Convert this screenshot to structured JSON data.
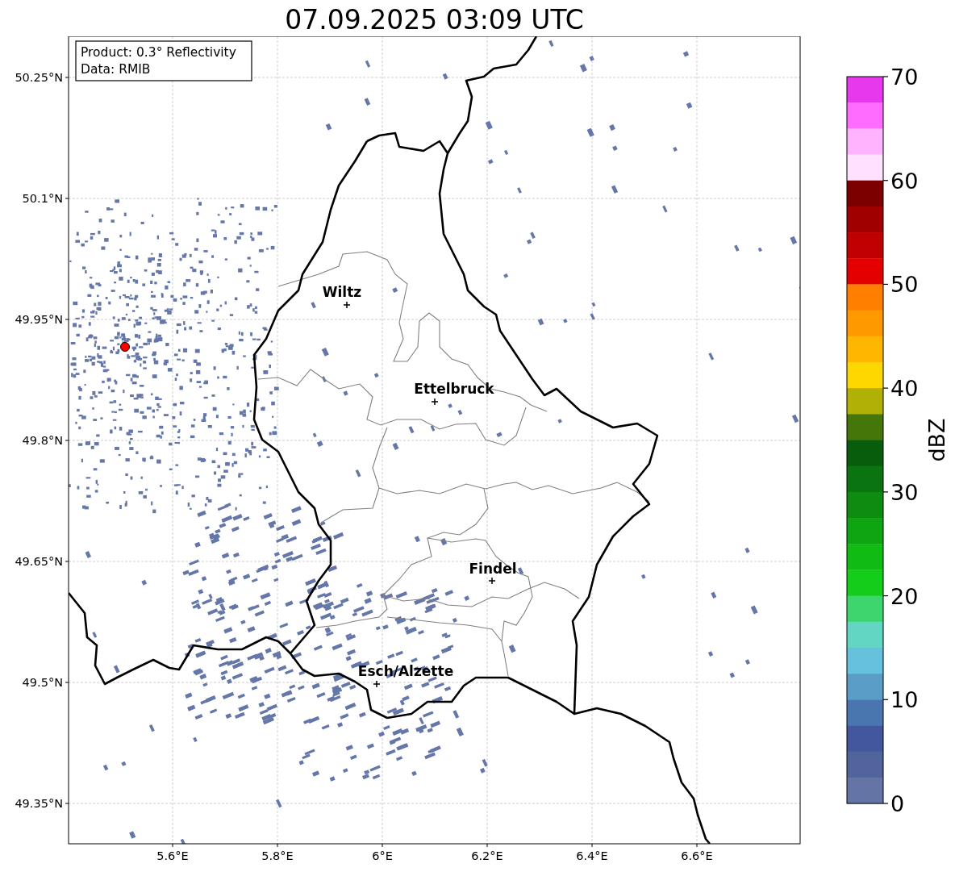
{
  "figure": {
    "title": "07.09.2025 03:09 UTC",
    "info_box": [
      "Product: 0.3° Reflectivity",
      "Data: RMIB"
    ],
    "map": {
      "xticks": [
        "5.6°E",
        "5.8°E",
        "6°E",
        "6.2°E",
        "6.4°E",
        "6.6°E"
      ],
      "yticks": [
        "50.25°N",
        "50.1°N",
        "49.95°N",
        "49.8°N",
        "49.65°N",
        "49.5°N",
        "49.35°N"
      ],
      "radar_site": {
        "color": "#ff0000"
      },
      "cities": [
        {
          "name": "Wiltz"
        },
        {
          "name": "Ettelbruck"
        },
        {
          "name": "Findel"
        },
        {
          "name": "Esch/Alzette"
        }
      ]
    },
    "colorbar": {
      "label": "dBZ",
      "ticks": [
        "70",
        "60",
        "50",
        "40",
        "30",
        "20",
        "10",
        "0"
      ],
      "bins": [
        {
          "color": "#e838ee"
        },
        {
          "color": "#ff6cff"
        },
        {
          "color": "#ffb3ff"
        },
        {
          "color": "#ffe1ff"
        },
        {
          "color": "#7d0000"
        },
        {
          "color": "#a00000"
        },
        {
          "color": "#c00000"
        },
        {
          "color": "#e40000"
        },
        {
          "color": "#ff7f00"
        },
        {
          "color": "#ff9900"
        },
        {
          "color": "#ffb600"
        },
        {
          "color": "#ffd700"
        },
        {
          "color": "#b0b005"
        },
        {
          "color": "#44760a"
        },
        {
          "color": "#085d0c"
        },
        {
          "color": "#0a7510"
        },
        {
          "color": "#0e8c12"
        },
        {
          "color": "#0fa512"
        },
        {
          "color": "#10bb14"
        },
        {
          "color": "#14cc1a"
        },
        {
          "color": "#3dd56d"
        },
        {
          "color": "#63d6c3"
        },
        {
          "color": "#65c1de"
        },
        {
          "color": "#5a9ec8"
        },
        {
          "color": "#4a76b0"
        },
        {
          "color": "#42579e"
        },
        {
          "color": "#52649c"
        },
        {
          "color": "#6475a5"
        }
      ]
    }
  }
}
